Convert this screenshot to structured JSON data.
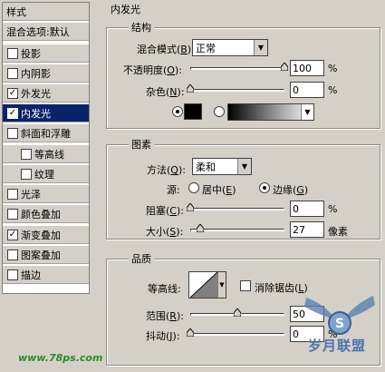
{
  "sidebar": {
    "items": [
      {
        "label": "样式",
        "type": "header"
      },
      {
        "label": "混合选项:默认",
        "type": "header"
      },
      {
        "label": "投影",
        "checked": false
      },
      {
        "label": "内阴影",
        "checked": false
      },
      {
        "label": "外发光",
        "checked": true
      },
      {
        "label": "内发光",
        "checked": true,
        "selected": true
      },
      {
        "label": "斜面和浮雕",
        "checked": false
      },
      {
        "label": "等高线",
        "checked": false,
        "indent": true
      },
      {
        "label": "纹理",
        "checked": false,
        "indent": true
      },
      {
        "label": "光泽",
        "checked": false
      },
      {
        "label": "颜色叠加",
        "checked": false
      },
      {
        "label": "渐变叠加",
        "checked": true
      },
      {
        "label": "图案叠加",
        "checked": false
      },
      {
        "label": "描边",
        "checked": false
      }
    ],
    "check_glyph": "✓"
  },
  "panel": {
    "title": "内发光",
    "structure": {
      "title": "结构",
      "blend_mode_label": "混合模式",
      "blend_mode_key": "B",
      "blend_mode_value": "正常",
      "opacity_label": "不透明度",
      "opacity_key": "O",
      "opacity_value": "100",
      "noise_label": "杂色",
      "noise_key": "N",
      "noise_value": "0",
      "percent": "%",
      "color_swatch": "#000000",
      "opacity_fraction": 1.0,
      "noise_fraction": 0.0
    },
    "elements": {
      "title": "图素",
      "method_label": "方法",
      "method_key": "Q",
      "method_value": "柔和",
      "source_label": "源:",
      "source_center_label": "居中",
      "source_center_key": "E",
      "source_edge_label": "边缘",
      "source_edge_key": "G",
      "choke_label": "阻塞",
      "choke_key": "C",
      "choke_value": "0",
      "size_label": "大小",
      "size_key": "S",
      "size_value": "27",
      "pixels": "像素",
      "percent": "%",
      "choke_fraction": 0.0,
      "size_fraction": 0.11
    },
    "quality": {
      "title": "品质",
      "contour_label": "等高线:",
      "antialias_label": "消除锯齿",
      "antialias_key": "L",
      "range_label": "范围",
      "range_key": "R",
      "range_value": "50",
      "jitter_label": "抖动",
      "jitter_key": "J",
      "jitter_value": "0",
      "percent": "%",
      "range_fraction": 0.5,
      "jitter_fraction": 0.0
    }
  },
  "watermark": {
    "left": "www.78ps.com",
    "right": "岁月联盟"
  }
}
